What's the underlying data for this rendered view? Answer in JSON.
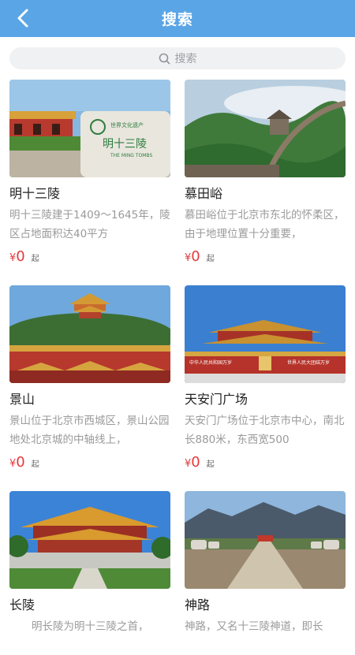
{
  "header": {
    "title": "搜索",
    "back_icon": "chevron-left-icon"
  },
  "search": {
    "placeholder": "搜索",
    "icon": "search-icon"
  },
  "spots": [
    {
      "name": "明十三陵",
      "desc": "明十三陵建于1409～1645年，陵区占地面积达40平方",
      "currency": "¥",
      "price": "0",
      "suffix": "起",
      "sign_line1": "世界文化遗产",
      "sign_line2": "明十三陵",
      "sign_line3": "THE MING TOMBS"
    },
    {
      "name": "慕田峪",
      "desc": "慕田峪位于北京市东北的怀柔区，由于地理位置十分重要，",
      "currency": "¥",
      "price": "0",
      "suffix": "起"
    },
    {
      "name": "景山",
      "desc": "景山位于北京市西城区，景山公园地处北京城的中轴线上，",
      "currency": "¥",
      "price": "0",
      "suffix": "起"
    },
    {
      "name": "天安门广场",
      "desc": "天安门广场位于北京市中心，南北长880米，东西宽500",
      "currency": "¥",
      "price": "0",
      "suffix": "起",
      "banner_left": "中华人民共和国万岁",
      "banner_right": "世界人民大团结万岁"
    },
    {
      "name": "长陵",
      "desc": "明长陵为明十三陵之首，",
      "currency": "",
      "price": "",
      "suffix": ""
    },
    {
      "name": "神路",
      "desc": "神路，又名十三陵神道，即长",
      "currency": "",
      "price": "",
      "suffix": ""
    }
  ],
  "colors": {
    "header": "#5aa5e6",
    "price": "#e4393c"
  }
}
